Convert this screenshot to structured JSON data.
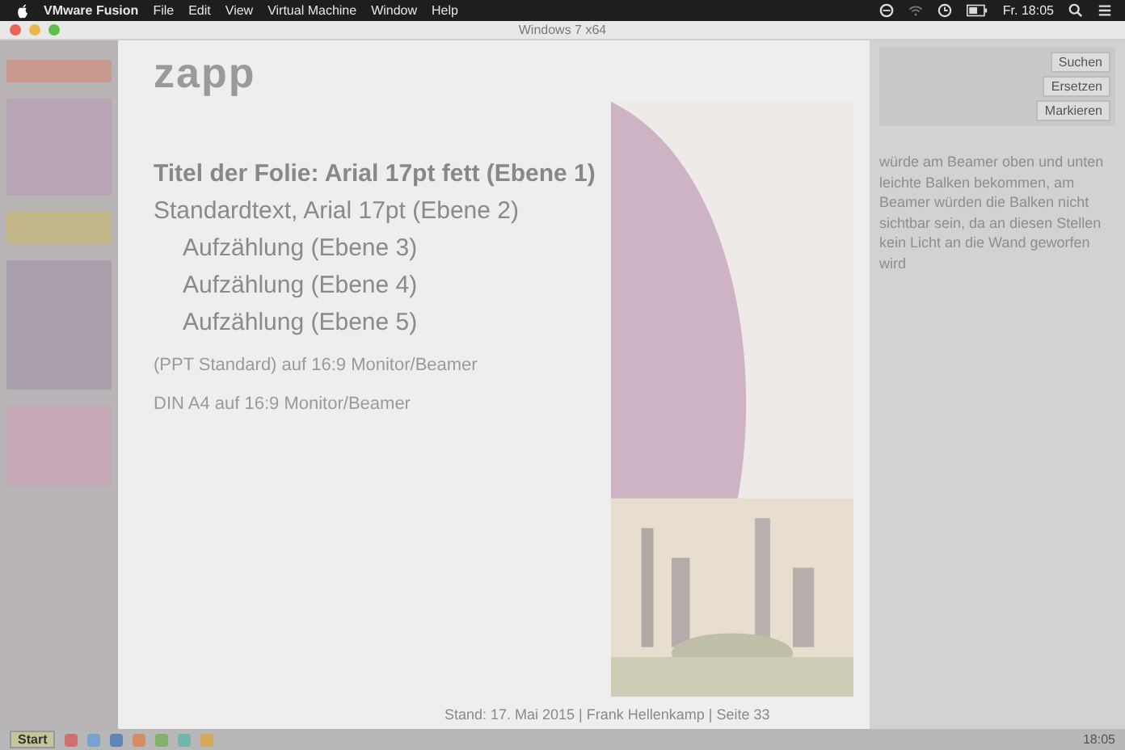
{
  "menu_bar": {
    "app": "VMware Fusion",
    "menus": [
      "File",
      "Edit",
      "View",
      "Virtual Machine",
      "Window",
      "Help"
    ],
    "clock": "Fr. 18:05"
  },
  "window": {
    "title": "Windows 7 x64"
  },
  "logo": "zapp",
  "slide_text": [
    {
      "kind": "title",
      "text": "Titel der Folie: Arial 17pt fett (Ebene 1)"
    },
    {
      "kind": "body",
      "text": "Standardtext, Arial 17pt (Ebene 2)"
    },
    {
      "kind": "bullet",
      "text": "Aufzählung (Ebene 3)"
    },
    {
      "kind": "bullet",
      "text": "Aufzählung (Ebene 4)"
    },
    {
      "kind": "bullet",
      "text": "Aufzählung (Ebene 5)"
    }
  ],
  "captions": [
    "(PPT Standard) auf 16:9 Monitor/Beamer",
    "DIN A4 auf 16:9 Monitor/Beamer"
  ],
  "note": "würde am Beamer oben und unten leichte Balken bekommen, am Beamer würden die Balken nicht sichtbar sein, da an diesen Stellen kein Licht an die Wand geworfen wird",
  "ribbon_actions": [
    "Suchen",
    "Ersetzen",
    "Markieren"
  ],
  "footer": "Stand: 17. Mai 2015 | Frank Hellenkamp | Seite 33",
  "taskbar": {
    "start": "Start",
    "clock": "18:05"
  }
}
